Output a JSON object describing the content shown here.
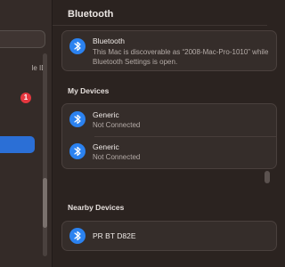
{
  "sidebar": {
    "apple_id_label": "le ID",
    "badge_count": "1"
  },
  "main": {
    "title": "Bluetooth",
    "bluetooth_row": {
      "title": "Bluetooth",
      "subtitle_line1": "This Mac is discoverable as “2008-Mac-Pro-1010” while",
      "subtitle_line2": "Bluetooth Settings is open."
    },
    "my_devices": {
      "title": "My Devices",
      "devices": [
        {
          "name": "Generic",
          "status": "Not Connected"
        },
        {
          "name": "Generic",
          "status": "Not Connected"
        }
      ]
    },
    "nearby_devices": {
      "title": "Nearby Devices",
      "devices": [
        {
          "name": "PR BT D82E"
        }
      ]
    }
  },
  "colors": {
    "accent": "#2b6fd6",
    "bluetooth_icon": "#2b82f0",
    "badge": "#e5373f"
  }
}
